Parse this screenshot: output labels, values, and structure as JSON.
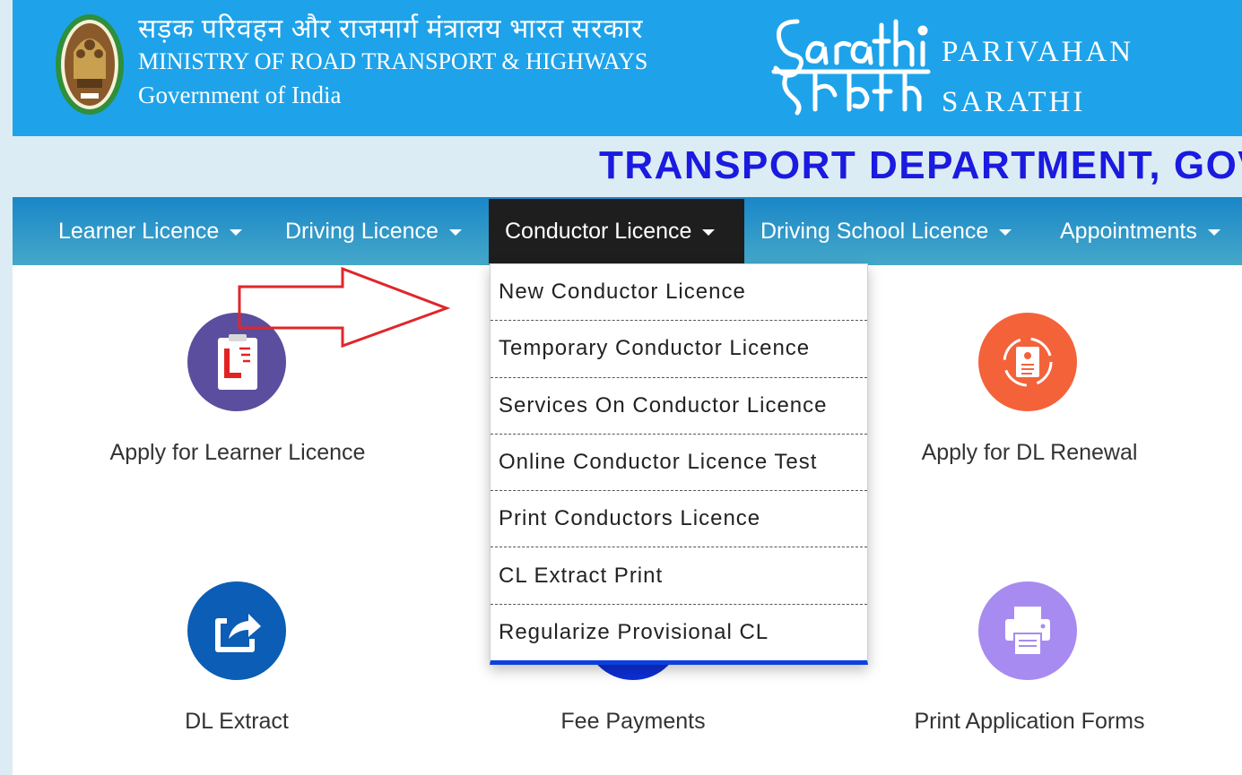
{
  "header": {
    "hindi_title": "सड़क परिवहन और राजमार्ग मंत्रालय भारत सरकार",
    "ministry": "MINISTRY OF ROAD TRANSPORT & HIGHWAYS",
    "government": "Government of India",
    "emblem_icon": "national-emblem-icon",
    "logo_icon": "sarathi-logo-icon",
    "parivahan": "PARIVAHAN",
    "sarathi": "SARATHI"
  },
  "department": {
    "title": "TRANSPORT DEPARTMENT, GOV"
  },
  "nav": {
    "items": [
      {
        "label": "Learner Licence"
      },
      {
        "label": "Driving Licence"
      },
      {
        "label": "Conductor Licence"
      },
      {
        "label": "Driving School Licence"
      },
      {
        "label": "Appointments"
      }
    ],
    "active": "Conductor Licence"
  },
  "dropdown": {
    "items": [
      "New Conductor Licence",
      "Temporary Conductor Licence",
      "Services On Conductor Licence",
      "Online Conductor Licence Test",
      "Print Conductors Licence",
      "CL Extract Print",
      "Regularize Provisional CL"
    ],
    "accent_color": "#0b3fe0"
  },
  "tiles": [
    {
      "label": "Apply for Learner Licence",
      "icon": "learner-licence-icon",
      "color": "#5b4e9e"
    },
    {
      "label": "Apply for DL Renewal",
      "icon": "dl-renewal-icon",
      "color": "#f4623a"
    },
    {
      "label": "DL Extract",
      "icon": "share-export-icon",
      "color": "#0b5db5"
    },
    {
      "label": "Fee Payments",
      "icon": "fee-payment-icon",
      "color": "#0d2fd6"
    },
    {
      "label": "Print Application Forms",
      "icon": "printer-icon",
      "color": "#a78bf0"
    }
  ],
  "annotation": {
    "icon": "red-arrow-pointer-icon",
    "color": "#e0262b"
  },
  "colors": {
    "header_blue": "#1ea3ea",
    "nav_active": "#1e1e1e",
    "dept_title": "#1a1ae0"
  }
}
